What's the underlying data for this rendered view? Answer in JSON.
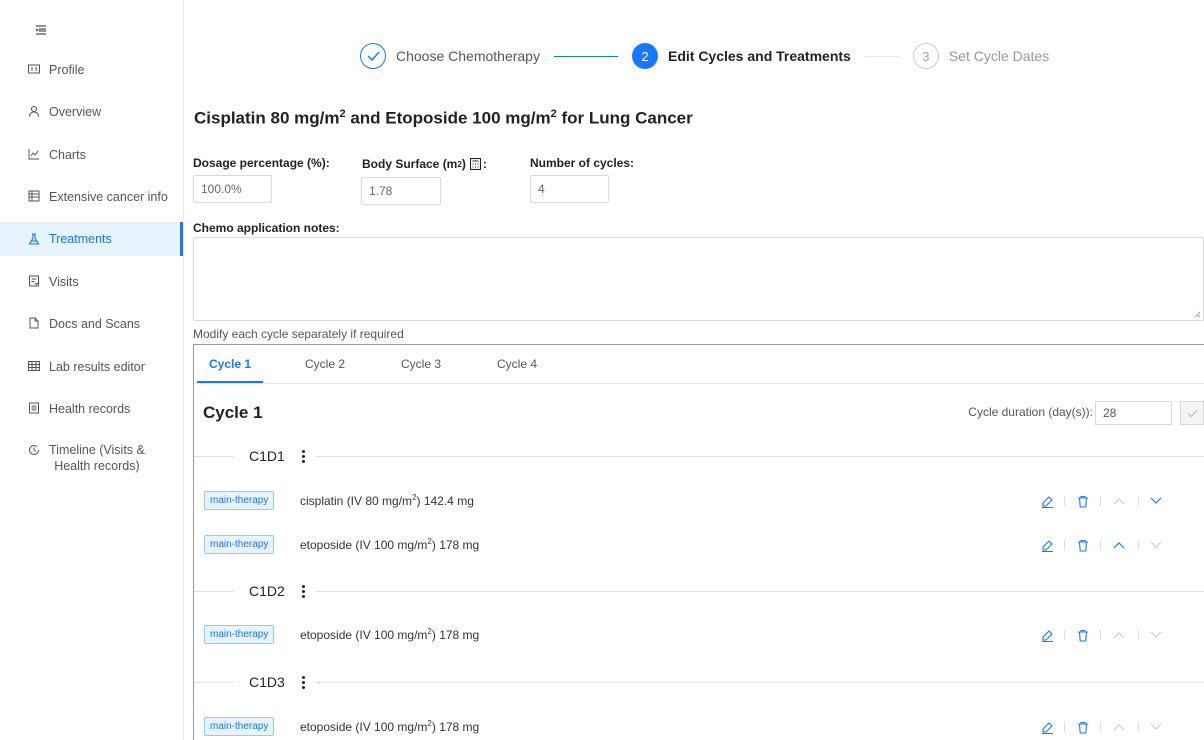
{
  "sidebar": {
    "items": [
      {
        "label": "Profile",
        "icon": "id-card-icon"
      },
      {
        "label": "Overview",
        "icon": "user-icon"
      },
      {
        "label": "Charts",
        "icon": "chart-icon"
      },
      {
        "label": "Extensive cancer info",
        "icon": "database-icon"
      },
      {
        "label": "Treatments",
        "icon": "flask-icon",
        "active": true
      },
      {
        "label": "Visits",
        "icon": "clipboard-icon"
      },
      {
        "label": "Docs and Scans",
        "icon": "file-icon"
      },
      {
        "label": "Lab results editor",
        "icon": "table-icon"
      },
      {
        "label": "Health records",
        "icon": "record-icon"
      },
      {
        "label": "Timeline (Visits &",
        "label2": "Health records)",
        "icon": "history-icon"
      }
    ]
  },
  "steps": [
    {
      "label": "Choose Chemotherapy",
      "status": "done"
    },
    {
      "num": "2",
      "label": "Edit Cycles and Treatments",
      "status": "active"
    },
    {
      "num": "3",
      "label": "Set Cycle Dates",
      "status": "wait"
    }
  ],
  "regimen": {
    "title_a": "Cisplatin 80 mg/m",
    "title_b": " and Etoposide 100 mg/m",
    "title_c": " for Lung Cancer",
    "sup": "2"
  },
  "form": {
    "dosage_label": "Dosage percentage (%):",
    "dosage_value": "100.0%",
    "bsa_label_a": "Body Surface (m",
    "bsa_label_b": ")",
    "bsa_sup": "2",
    "bsa_value": "1.78",
    "cycles_label": "Number of cycles:",
    "cycles_value": "4",
    "notes_label": "Chemo application notes:",
    "hint": "Modify each cycle separately if required"
  },
  "tabs": [
    "Cycle 1",
    "Cycle 2",
    "Cycle 3",
    "Cycle 4"
  ],
  "cycle": {
    "title": "Cycle 1",
    "duration_label": "Cycle duration (day(s)):",
    "duration_value": "28"
  },
  "days": [
    "C1D1",
    "C1D2",
    "C1D3"
  ],
  "treatments": [
    {
      "tag": "main-therapy",
      "text_a": "cisplatin (IV 80 mg/m",
      "sup": "2",
      "text_b": ") 142.4 mg"
    },
    {
      "tag": "main-therapy",
      "text_a": "etoposide (IV 100 mg/m",
      "sup": "2",
      "text_b": ") 178 mg"
    },
    {
      "tag": "main-therapy",
      "text_a": "etoposide (IV 100 mg/m",
      "sup": "2",
      "text_b": ") 178 mg"
    },
    {
      "tag": "main-therapy",
      "text_a": "etoposide (IV 100 mg/m",
      "sup": "2",
      "text_b": ") 178 mg"
    }
  ],
  "colors": {
    "accent": "#1677ff",
    "tag_bg": "#e6f4ff",
    "active_bg": "#e6f4ff"
  }
}
